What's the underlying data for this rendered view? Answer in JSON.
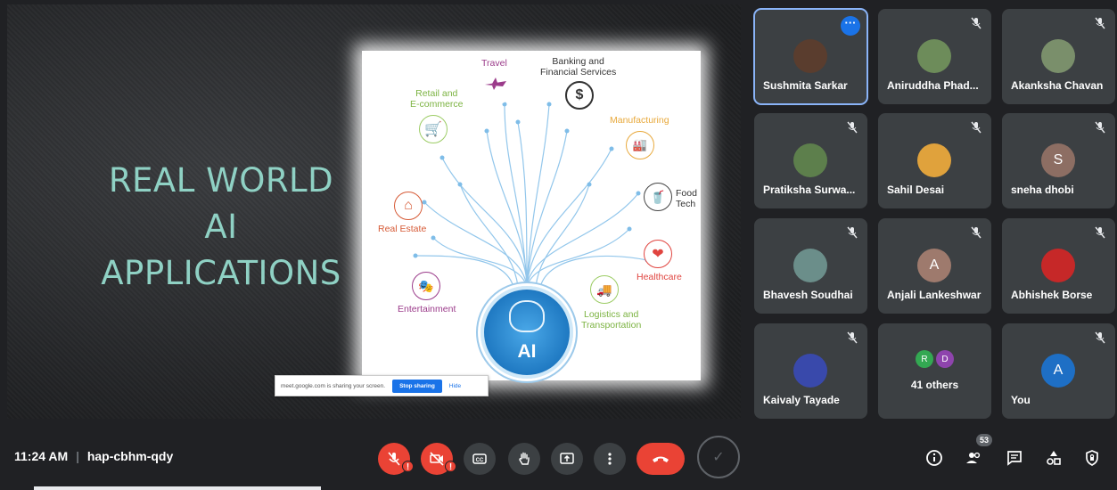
{
  "slide": {
    "title_lines": [
      "REAL WORLD",
      "AI",
      "APPLICATIONS"
    ],
    "figure": {
      "center_label": "AI",
      "labels": {
        "travel": "Travel",
        "banking": "Banking and\nFinancial Services",
        "retail": "Retail and\nE-commerce",
        "manufacturing": "Manufacturing",
        "food": "Food\nTech",
        "real_estate": "Real Estate",
        "healthcare": "Healthcare",
        "entertainment": "Entertainment",
        "logistics": "Logistics and\nTransportation"
      }
    }
  },
  "share_banner": {
    "text": "meet.google.com is sharing your screen.",
    "stop_label": "Stop sharing",
    "hide_label": "Hide"
  },
  "participants": [
    {
      "name": "Sushmita Sarkar",
      "active": true
    },
    {
      "name": "Aniruddha Phad...",
      "active": false
    },
    {
      "name": "Akanksha Chavan",
      "active": false
    },
    {
      "name": "Pratiksha Surwa...",
      "active": false
    },
    {
      "name": "Sahil Desai",
      "active": false
    },
    {
      "name": "sneha dhobi",
      "initial": "S",
      "active": false
    },
    {
      "name": "Bhavesh Soudhai",
      "active": false
    },
    {
      "name": "Anjali Lankeshwar",
      "initial": "A",
      "active": false
    },
    {
      "name": "Abhishek Borse",
      "active": false
    },
    {
      "name": "Kaivaly Tayade",
      "active": false
    },
    {
      "name": "You",
      "initial": "A",
      "active": false
    }
  ],
  "others_tile": {
    "label": "41 others",
    "initials": [
      "R",
      "D"
    ]
  },
  "bottom_bar": {
    "time": "11:24 AM",
    "meeting_code": "hap-cbhm-qdy",
    "people_count": "53"
  },
  "colors": {
    "background": "#202124",
    "tile": "#3c4043",
    "accent_blue": "#1a73e8",
    "danger_red": "#ea4335",
    "slide_title": "#8fd1c4"
  }
}
